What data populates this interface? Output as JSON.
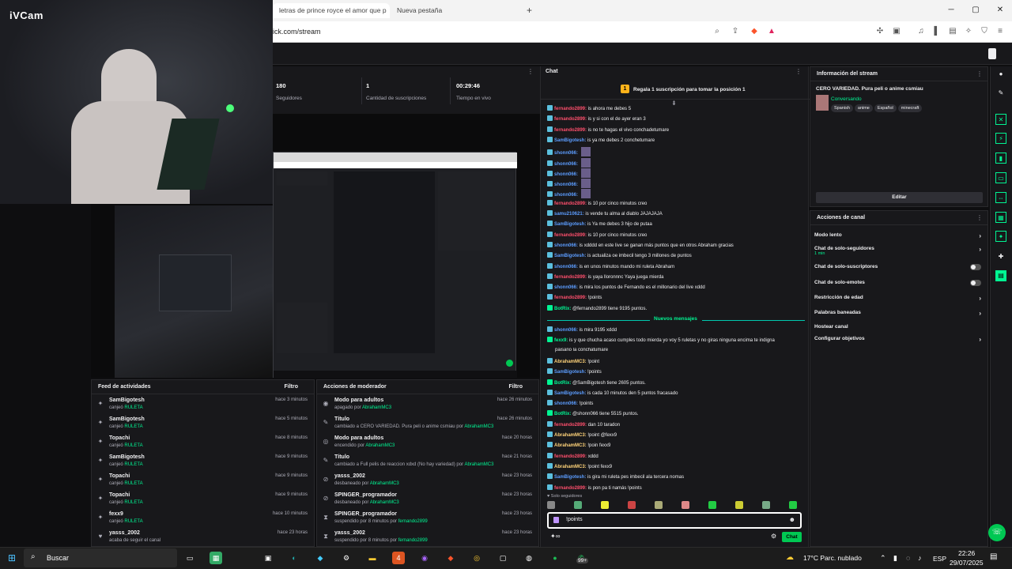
{
  "browser": {
    "tabs": [
      "letras de prince royce el amor que p",
      "Nueva pestaña"
    ],
    "new_tab": "+",
    "url": "ick.com/stream",
    "win_min": "─",
    "win_max": "▢",
    "win_close": "✕"
  },
  "webcam": {
    "brand": "iVCam"
  },
  "stats": [
    {
      "value": "180",
      "label": "Seguidores"
    },
    {
      "value": "1",
      "label": "Cantidad de suscripciones"
    },
    {
      "value": "00:29:46",
      "label": "Tiempo en vivo"
    }
  ],
  "activity": {
    "title": "Feed de actividades",
    "filter": "Filtro",
    "items": [
      {
        "name": "SamBigotesh",
        "desc": "canjeó",
        "hl": "RULETA",
        "time": "hace 3 minutos"
      },
      {
        "name": "SamBigotesh",
        "desc": "canjeó",
        "hl": "RULETA",
        "time": "hace 5 minutos"
      },
      {
        "name": "Topachi",
        "desc": "canjeó",
        "hl": "RULETA",
        "time": "hace 8 minutos"
      },
      {
        "name": "SamBigotesh",
        "desc": "canjeó",
        "hl": "RULETA",
        "time": "hace 9 minutos"
      },
      {
        "name": "Topachi",
        "desc": "canjeó",
        "hl": "RULETA",
        "time": "hace 9 minutos"
      },
      {
        "name": "Topachi",
        "desc": "canjeó",
        "hl": "RULETA",
        "time": "hace 9 minutos"
      },
      {
        "name": "fexx9",
        "desc": "canjeó",
        "hl": "RULETA",
        "time": "hace 10 minutos"
      },
      {
        "name": "yasss_2002",
        "desc": "acaba de seguir el canal",
        "hl": "",
        "time": "hace 23 horas"
      }
    ]
  },
  "mod": {
    "title": "Acciones de moderador",
    "filter": "Filtro",
    "items": [
      {
        "icon": "◉",
        "name": "Modo para adultos",
        "desc": "apagado por",
        "by": "AbrahamMC3",
        "time": "hace 26 minutos"
      },
      {
        "icon": "✎",
        "name": "Título",
        "desc": "cambiado a CERO VARIEDAD. Pura peli o anime csmiau por",
        "by": "AbrahamMC3",
        "time": "hace 26 minutos"
      },
      {
        "icon": "◎",
        "name": "Modo para adultos",
        "desc": "encendido por",
        "by": "AbrahamMC3",
        "time": "hace 20 horas"
      },
      {
        "icon": "✎",
        "name": "Título",
        "desc": "cambiado a Full pelis de reaccion xdxd (No hay variedad) por",
        "by": "AbrahamMC3",
        "time": "hace 21 horas"
      },
      {
        "icon": "⊘",
        "name": "yasss_2002",
        "desc": "desbaneado por",
        "by": "AbrahamMC3",
        "time": "hace 23 horas"
      },
      {
        "icon": "⊘",
        "name": "SPINGER_programador",
        "desc": "desbaneado por",
        "by": "AbrahamMC3",
        "time": "hace 23 horas"
      },
      {
        "icon": "⧗",
        "name": "SPINGER_programador",
        "desc": "suspendido por 8 minutos por",
        "by": "fernando2899",
        "time": "hace 23 horas"
      },
      {
        "icon": "⧗",
        "name": "yasss_2002",
        "desc": "suspendido por 8 minutos por",
        "by": "fernando2899",
        "time": "hace 23 horas"
      }
    ]
  },
  "chat": {
    "title": "Chat",
    "banner": "Regala 1 suscripción para tomar la posición 1",
    "new_messages": "Nuevos mensajes",
    "followers_only": "♥ Solo seguidores",
    "input_value": "!points",
    "send": "Chat",
    "lines": [
      {
        "user": "fernando2899:",
        "color": "#ff4f6d",
        "text": "is ahora me debes 5"
      },
      {
        "user": "fernando2899:",
        "color": "#ff4f6d",
        "text": "is y si con el de ayer eran 3"
      },
      {
        "user": "fernando2899:",
        "color": "#ff4f6d",
        "text": "is no te hagas el vivo conchadetumare"
      },
      {
        "user": "SamBigotesh:",
        "color": "#5c9dff",
        "text": "is ya me debes 2 conchetumare"
      },
      {
        "user": "shonn066:",
        "color": "#5c9dff",
        "text": ""
      },
      {
        "user": "shonn066:",
        "color": "#5c9dff",
        "text": ""
      },
      {
        "user": "shonn066:",
        "color": "#5c9dff",
        "text": ""
      },
      {
        "user": "shonn066:",
        "color": "#5c9dff",
        "text": ""
      },
      {
        "user": "shonn066:",
        "color": "#5c9dff",
        "text": ""
      },
      {
        "user": "fernando2899:",
        "color": "#ff4f6d",
        "text": "is 10 por cinco minutos creo"
      },
      {
        "user": "samu210621:",
        "color": "#5c9dff",
        "text": "is vende tu alma al diablo JAJAJAJA"
      },
      {
        "user": "SamBigotesh:",
        "color": "#5c9dff",
        "text": "is Ya me debes 3 hijo de putaa"
      },
      {
        "user": "fernando2899:",
        "color": "#ff4f6d",
        "text": "is 10 por cinco minutos creo"
      },
      {
        "user": "shonn066:",
        "color": "#5c9dff",
        "text": "is xdddd en este live se ganan más puntos que en otros Abraham gracias"
      },
      {
        "user": "SamBigotesh:",
        "color": "#5c9dff",
        "text": "is actualiza oe imbecil tengo 3 millones de puntos"
      },
      {
        "user": "shonn066:",
        "color": "#5c9dff",
        "text": "is en unos minutos mando mi ruleta Abraham"
      },
      {
        "user": "fernando2899:",
        "color": "#ff4f6d",
        "text": "is yaya lloronnnc Yaya juega mierda"
      },
      {
        "user": "shonn066:",
        "color": "#5c9dff",
        "text": "is mira los puntos de Fernando es el millonario del live xddd"
      },
      {
        "user": "fernando2899:",
        "color": "#ff4f6d",
        "text": "!points"
      },
      {
        "user": "BotRix:",
        "color": "#00f593",
        "text": "@fernando2899 tiene 9195 puntos."
      }
    ],
    "lines2": [
      {
        "user": "shonn066:",
        "color": "#5c9dff",
        "text": "is mira 9195 xddd"
      },
      {
        "user": "fexx9:",
        "color": "#00f593",
        "text": "is y que chucha acaso cumples todo mierda yo voy 5 ruletas y no giras ninguna encima te indigna"
      },
      {
        "user": "",
        "color": "#efeff1",
        "text": "paisano la conchatumare"
      },
      {
        "user": "AbrahamMC3:",
        "color": "#ffd37a",
        "text": "!point"
      },
      {
        "user": "SamBigotesh:",
        "color": "#5c9dff",
        "text": "!points"
      },
      {
        "user": "BotRix:",
        "color": "#00f593",
        "text": "@SamBigotesh tiene 2605 puntos."
      },
      {
        "user": "SamBigotesh:",
        "color": "#5c9dff",
        "text": "is cada 10 minutos den 5 puntos fracasado"
      },
      {
        "user": "shonn066:",
        "color": "#5c9dff",
        "text": "!points"
      },
      {
        "user": "BotRix:",
        "color": "#00f593",
        "text": "@shonn066 tiene 5515 puntos."
      },
      {
        "user": "fernando2899:",
        "color": "#ff4f6d",
        "text": "dan 10 taradon"
      },
      {
        "user": "AbrahamMC3:",
        "color": "#ffd37a",
        "text": "!point @fexx9"
      },
      {
        "user": "AbrahamMC3:",
        "color": "#ffd37a",
        "text": "!poin fexx9"
      },
      {
        "user": "fernando2899:",
        "color": "#ff4f6d",
        "text": "xddd"
      },
      {
        "user": "AbrahamMC3:",
        "color": "#ffd37a",
        "text": "!point fexx9"
      },
      {
        "user": "SamBigotesh:",
        "color": "#5c9dff",
        "text": "is gira mi ruleta pes imbecil ala tercera nomas"
      },
      {
        "user": "fernando2899:",
        "color": "#ff4f6d",
        "text": "is pon pa ti namás !points"
      }
    ]
  },
  "info": {
    "title": "Información del stream",
    "stream_title": "CERO VARIEDAD. Pura peli o anime csmiau",
    "category": "Conversando",
    "tags": [
      "Spanish",
      "anime",
      "Español",
      "minecraft"
    ],
    "edit": "Editar"
  },
  "actions": {
    "title": "Acciones de canal",
    "items": [
      {
        "label": "Modo lento",
        "type": "chev",
        "sub": ""
      },
      {
        "label": "Chat de solo-seguidores",
        "type": "chev",
        "sub": "1 min"
      },
      {
        "label": "Chat de solo-suscriptores",
        "type": "toggle",
        "sub": ""
      },
      {
        "label": "Chat de solo-emotes",
        "type": "toggle",
        "sub": ""
      },
      {
        "label": "Restricción de edad",
        "type": "chev",
        "sub": ""
      },
      {
        "label": "Palabras baneadas",
        "type": "chev",
        "sub": ""
      },
      {
        "label": "Hostear canal",
        "type": "none",
        "sub": ""
      },
      {
        "label": "Configurar objetivos",
        "type": "chev",
        "sub": ""
      }
    ]
  },
  "taskbar": {
    "search": "Buscar",
    "weather": "17°C  Parc. nublado",
    "lang": "ESP",
    "time": "22:26",
    "date": "29/07/2025",
    "badge": "99+"
  },
  "colors": {
    "accent": "#00f593",
    "bg": "#18181b"
  }
}
